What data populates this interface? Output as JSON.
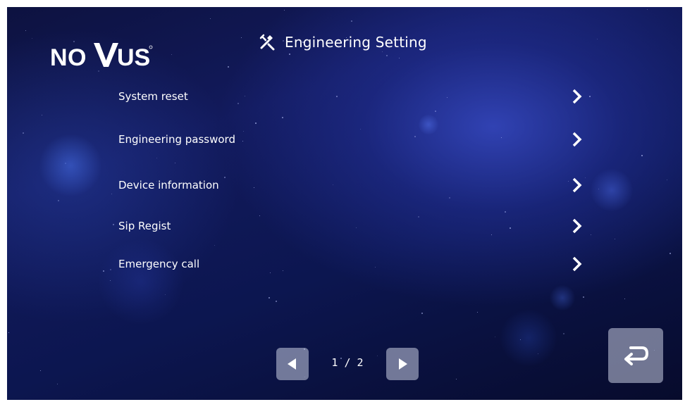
{
  "brand": {
    "logo_text": "NOVUS"
  },
  "header": {
    "title": "Engineering Setting",
    "icon": "tools-icon"
  },
  "menu": {
    "items": [
      {
        "label": "System reset",
        "icon": "chevron-right-icon"
      },
      {
        "label": "Engineering password",
        "icon": "chevron-right-icon"
      },
      {
        "label": "Device information",
        "icon": "chevron-right-icon"
      },
      {
        "label": "Sip Regist",
        "icon": "chevron-right-icon"
      },
      {
        "label": "Emergency call",
        "icon": "chevron-right-icon"
      }
    ]
  },
  "pager": {
    "indicator": "1 / 2",
    "prev_icon": "triangle-left-icon",
    "next_icon": "triangle-right-icon"
  },
  "back": {
    "icon": "return-arrow-icon"
  },
  "colors": {
    "text": "#ffffff",
    "background_dark": "#0c1650",
    "background_glow": "#3c50d2",
    "button_bg": "#c8cde1"
  }
}
